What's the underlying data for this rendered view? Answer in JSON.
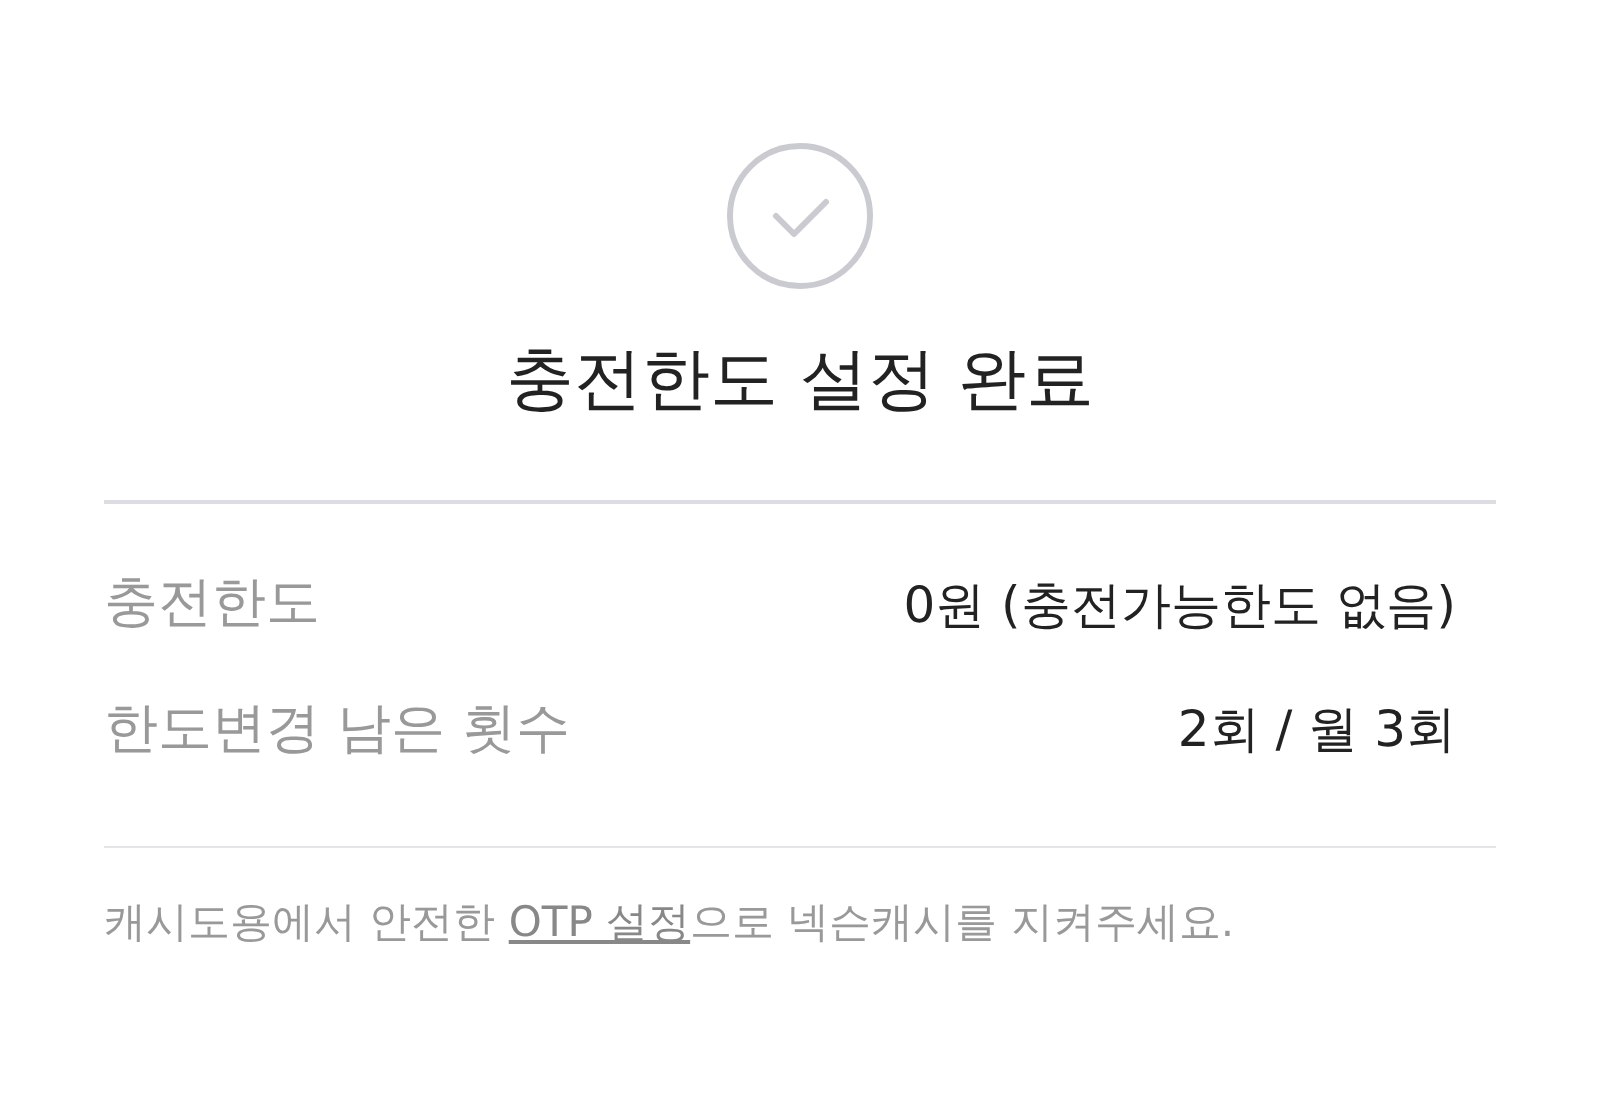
{
  "title": "충전한도 설정 완료",
  "rows": [
    {
      "label": "충전한도",
      "value": "0원 (충전가능한도 없음)"
    },
    {
      "label": "한도변경 남은 횟수",
      "value": "2회 / 월 3회"
    }
  ],
  "notice": {
    "before": "캐시도용에서 안전한 ",
    "link": "OTP 설정",
    "after": "으로 넥슨캐시를 지켜주세요."
  }
}
